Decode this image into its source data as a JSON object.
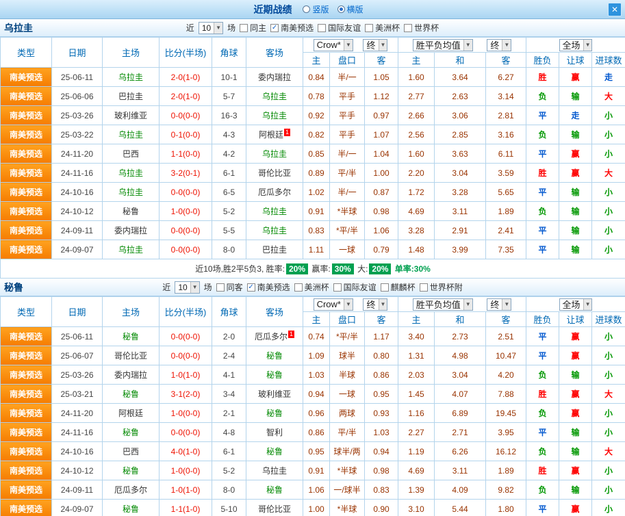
{
  "titlebar": {
    "title": "近期战绩",
    "radios": [
      {
        "label": "竖版",
        "selected": false
      },
      {
        "label": "横版",
        "selected": true
      }
    ]
  },
  "icons": {
    "check": "✓",
    "dropdown": "▼",
    "close": "✕"
  },
  "colors": {
    "header_text_blue": "#0069b4",
    "header_navy": "#00417e",
    "league_orange": "#ffa21f",
    "focus_team_green": "#008800",
    "score_red": "#ee1100",
    "odds_maroon": "#993300",
    "win_red": "#fe0000",
    "draw_blue": "#0057cf",
    "loss_green": "#009700",
    "summary_badge_green": "#00a050"
  },
  "table_header": {
    "type": "类型",
    "date": "日期",
    "home": "主场",
    "score": "比分(半场)",
    "corner": "角球",
    "away": "客场",
    "group1": [
      "Crow*",
      "终"
    ],
    "group2": [
      "胜平负均值",
      "终"
    ],
    "group3": [
      "全场"
    ],
    "sub": [
      "主",
      "盘口",
      "客",
      "主",
      "和",
      "客",
      "胜负",
      "让球",
      "进球数"
    ]
  },
  "sections": [
    {
      "team": "乌拉圭",
      "filter": {
        "near": "近",
        "count": "10",
        "unit": "场",
        "checkboxes": [
          {
            "label": "同主",
            "checked": false
          },
          {
            "label": "南美预选",
            "checked": true
          },
          {
            "label": "国际友谊",
            "checked": false
          },
          {
            "label": "美洲杯",
            "checked": false
          },
          {
            "label": "世界杯",
            "checked": false
          }
        ]
      },
      "rows": [
        {
          "league": "南美预选",
          "date": "25-06-11",
          "home": "乌拉圭",
          "hf": true,
          "score": "2-0(1-0)",
          "corner": "10-1",
          "away": "委内瑞拉",
          "o": [
            "0.84",
            "半/一",
            "1.05",
            "1.60",
            "3.64",
            "6.27"
          ],
          "r": [
            [
              "胜",
              "red"
            ],
            [
              "赢",
              "red"
            ],
            [
              "走",
              "blue"
            ]
          ]
        },
        {
          "league": "南美预选",
          "date": "25-06-06",
          "home": "巴拉圭",
          "score": "2-0(1-0)",
          "corner": "5-7",
          "away": "乌拉圭",
          "af": true,
          "o": [
            "0.78",
            "平手",
            "1.12",
            "2.77",
            "2.63",
            "3.14"
          ],
          "r": [
            [
              "负",
              "green"
            ],
            [
              "输",
              "green"
            ],
            [
              "大",
              "red"
            ]
          ]
        },
        {
          "league": "南美预选",
          "date": "25-03-26",
          "home": "玻利维亚",
          "score": "0-0(0-0)",
          "corner": "16-3",
          "away": "乌拉圭",
          "af": true,
          "o": [
            "0.92",
            "平手",
            "0.97",
            "2.66",
            "3.06",
            "2.81"
          ],
          "r": [
            [
              "平",
              "blue"
            ],
            [
              "走",
              "blue"
            ],
            [
              "小",
              "green"
            ]
          ]
        },
        {
          "league": "南美预选",
          "date": "25-03-22",
          "home": "乌拉圭",
          "hf": true,
          "score": "0-1(0-0)",
          "corner": "4-3",
          "away": "阿根廷",
          "ab": "1",
          "o": [
            "0.82",
            "平手",
            "1.07",
            "2.56",
            "2.85",
            "3.16"
          ],
          "r": [
            [
              "负",
              "green"
            ],
            [
              "输",
              "green"
            ],
            [
              "小",
              "green"
            ]
          ]
        },
        {
          "league": "南美预选",
          "date": "24-11-20",
          "home": "巴西",
          "score": "1-1(0-0)",
          "corner": "4-2",
          "away": "乌拉圭",
          "af": true,
          "o": [
            "0.85",
            "半/一",
            "1.04",
            "1.60",
            "3.63",
            "6.11"
          ],
          "r": [
            [
              "平",
              "blue"
            ],
            [
              "赢",
              "red"
            ],
            [
              "小",
              "green"
            ]
          ]
        },
        {
          "league": "南美预选",
          "date": "24-11-16",
          "home": "乌拉圭",
          "hf": true,
          "score": "3-2(0-1)",
          "corner": "6-1",
          "away": "哥伦比亚",
          "o": [
            "0.89",
            "平/半",
            "1.00",
            "2.20",
            "3.04",
            "3.59"
          ],
          "r": [
            [
              "胜",
              "red"
            ],
            [
              "赢",
              "red"
            ],
            [
              "大",
              "red"
            ]
          ]
        },
        {
          "league": "南美预选",
          "date": "24-10-16",
          "home": "乌拉圭",
          "hf": true,
          "score": "0-0(0-0)",
          "corner": "6-5",
          "away": "厄瓜多尔",
          "o": [
            "1.02",
            "半/一",
            "0.87",
            "1.72",
            "3.28",
            "5.65"
          ],
          "r": [
            [
              "平",
              "blue"
            ],
            [
              "输",
              "green"
            ],
            [
              "小",
              "green"
            ]
          ]
        },
        {
          "league": "南美预选",
          "date": "24-10-12",
          "home": "秘鲁",
          "score": "1-0(0-0)",
          "corner": "5-2",
          "away": "乌拉圭",
          "af": true,
          "o": [
            "0.91",
            "*半球",
            "0.98",
            "4.69",
            "3.11",
            "1.89"
          ],
          "r": [
            [
              "负",
              "green"
            ],
            [
              "输",
              "green"
            ],
            [
              "小",
              "green"
            ]
          ]
        },
        {
          "league": "南美预选",
          "date": "24-09-11",
          "home": "委内瑞拉",
          "score": "0-0(0-0)",
          "corner": "5-5",
          "away": "乌拉圭",
          "af": true,
          "o": [
            "0.83",
            "*平/半",
            "1.06",
            "3.28",
            "2.91",
            "2.41"
          ],
          "r": [
            [
              "平",
              "blue"
            ],
            [
              "输",
              "green"
            ],
            [
              "小",
              "green"
            ]
          ]
        },
        {
          "league": "南美预选",
          "date": "24-09-07",
          "home": "乌拉圭",
          "hf": true,
          "score": "0-0(0-0)",
          "corner": "8-0",
          "away": "巴拉圭",
          "o": [
            "1.11",
            "一球",
            "0.79",
            "1.48",
            "3.99",
            "7.35"
          ],
          "r": [
            [
              "平",
              "blue"
            ],
            [
              "输",
              "green"
            ],
            [
              "小",
              "green"
            ]
          ]
        }
      ],
      "summary": {
        "prefix": "近10场,胜2平5负3,",
        "stats": [
          {
            "label": "胜率:",
            "value": "20%"
          },
          {
            "label": "赢率:",
            "value": "30%"
          },
          {
            "label": "大:",
            "value": "20%"
          }
        ],
        "tail": "单率:30%"
      }
    },
    {
      "team": "秘鲁",
      "filter": {
        "near": "近",
        "count": "10",
        "unit": "场",
        "checkboxes": [
          {
            "label": "同客",
            "checked": false
          },
          {
            "label": "南美预选",
            "checked": true
          },
          {
            "label": "美洲杯",
            "checked": false
          },
          {
            "label": "国际友谊",
            "checked": false
          },
          {
            "label": "麒麟杯",
            "checked": false
          },
          {
            "label": "世界杯附",
            "checked": false
          }
        ]
      },
      "rows": [
        {
          "league": "南美预选",
          "date": "25-06-11",
          "home": "秘鲁",
          "hf": true,
          "score": "0-0(0-0)",
          "corner": "2-0",
          "away": "厄瓜多尔",
          "ab": "1",
          "o": [
            "0.74",
            "*平/半",
            "1.17",
            "3.40",
            "2.73",
            "2.51"
          ],
          "r": [
            [
              "平",
              "blue"
            ],
            [
              "赢",
              "red"
            ],
            [
              "小",
              "green"
            ]
          ]
        },
        {
          "league": "南美预选",
          "date": "25-06-07",
          "home": "哥伦比亚",
          "score": "0-0(0-0)",
          "corner": "2-4",
          "away": "秘鲁",
          "af": true,
          "o": [
            "1.09",
            "球半",
            "0.80",
            "1.31",
            "4.98",
            "10.47"
          ],
          "r": [
            [
              "平",
              "blue"
            ],
            [
              "赢",
              "red"
            ],
            [
              "小",
              "green"
            ]
          ]
        },
        {
          "league": "南美预选",
          "date": "25-03-26",
          "home": "委内瑞拉",
          "score": "1-0(1-0)",
          "corner": "4-1",
          "away": "秘鲁",
          "af": true,
          "o": [
            "1.03",
            "半球",
            "0.86",
            "2.03",
            "3.04",
            "4.20"
          ],
          "r": [
            [
              "负",
              "green"
            ],
            [
              "输",
              "green"
            ],
            [
              "小",
              "green"
            ]
          ]
        },
        {
          "league": "南美预选",
          "date": "25-03-21",
          "home": "秘鲁",
          "hf": true,
          "score": "3-1(2-0)",
          "corner": "3-4",
          "away": "玻利维亚",
          "o": [
            "0.94",
            "一球",
            "0.95",
            "1.45",
            "4.07",
            "7.88"
          ],
          "r": [
            [
              "胜",
              "red"
            ],
            [
              "赢",
              "red"
            ],
            [
              "大",
              "red"
            ]
          ]
        },
        {
          "league": "南美预选",
          "date": "24-11-20",
          "home": "阿根廷",
          "score": "1-0(0-0)",
          "corner": "2-1",
          "away": "秘鲁",
          "af": true,
          "o": [
            "0.96",
            "两球",
            "0.93",
            "1.16",
            "6.89",
            "19.45"
          ],
          "r": [
            [
              "负",
              "green"
            ],
            [
              "赢",
              "red"
            ],
            [
              "小",
              "green"
            ]
          ]
        },
        {
          "league": "南美预选",
          "date": "24-11-16",
          "home": "秘鲁",
          "hf": true,
          "score": "0-0(0-0)",
          "corner": "4-8",
          "away": "智利",
          "o": [
            "0.86",
            "平/半",
            "1.03",
            "2.27",
            "2.71",
            "3.95"
          ],
          "r": [
            [
              "平",
              "blue"
            ],
            [
              "输",
              "green"
            ],
            [
              "小",
              "green"
            ]
          ]
        },
        {
          "league": "南美预选",
          "date": "24-10-16",
          "home": "巴西",
          "score": "4-0(1-0)",
          "corner": "6-1",
          "away": "秘鲁",
          "af": true,
          "o": [
            "0.95",
            "球半/两",
            "0.94",
            "1.19",
            "6.26",
            "16.12"
          ],
          "r": [
            [
              "负",
              "green"
            ],
            [
              "输",
              "green"
            ],
            [
              "大",
              "red"
            ]
          ]
        },
        {
          "league": "南美预选",
          "date": "24-10-12",
          "home": "秘鲁",
          "hf": true,
          "score": "1-0(0-0)",
          "corner": "5-2",
          "away": "乌拉圭",
          "o": [
            "0.91",
            "*半球",
            "0.98",
            "4.69",
            "3.11",
            "1.89"
          ],
          "r": [
            [
              "胜",
              "red"
            ],
            [
              "赢",
              "red"
            ],
            [
              "小",
              "green"
            ]
          ]
        },
        {
          "league": "南美预选",
          "date": "24-09-11",
          "home": "厄瓜多尔",
          "score": "1-0(1-0)",
          "corner": "8-0",
          "away": "秘鲁",
          "af": true,
          "o": [
            "1.06",
            "一/球半",
            "0.83",
            "1.39",
            "4.09",
            "9.82"
          ],
          "r": [
            [
              "负",
              "green"
            ],
            [
              "输",
              "green"
            ],
            [
              "小",
              "green"
            ]
          ]
        },
        {
          "league": "南美预选",
          "date": "24-09-07",
          "home": "秘鲁",
          "hf": true,
          "score": "1-1(1-0)",
          "corner": "5-10",
          "away": "哥伦比亚",
          "o": [
            "1.00",
            "*半球",
            "0.90",
            "3.10",
            "5.44",
            "1.80"
          ],
          "r": [
            [
              "平",
              "blue"
            ],
            [
              "赢",
              "red"
            ],
            [
              "小",
              "green"
            ]
          ]
        }
      ],
      "summary": null
    }
  ]
}
